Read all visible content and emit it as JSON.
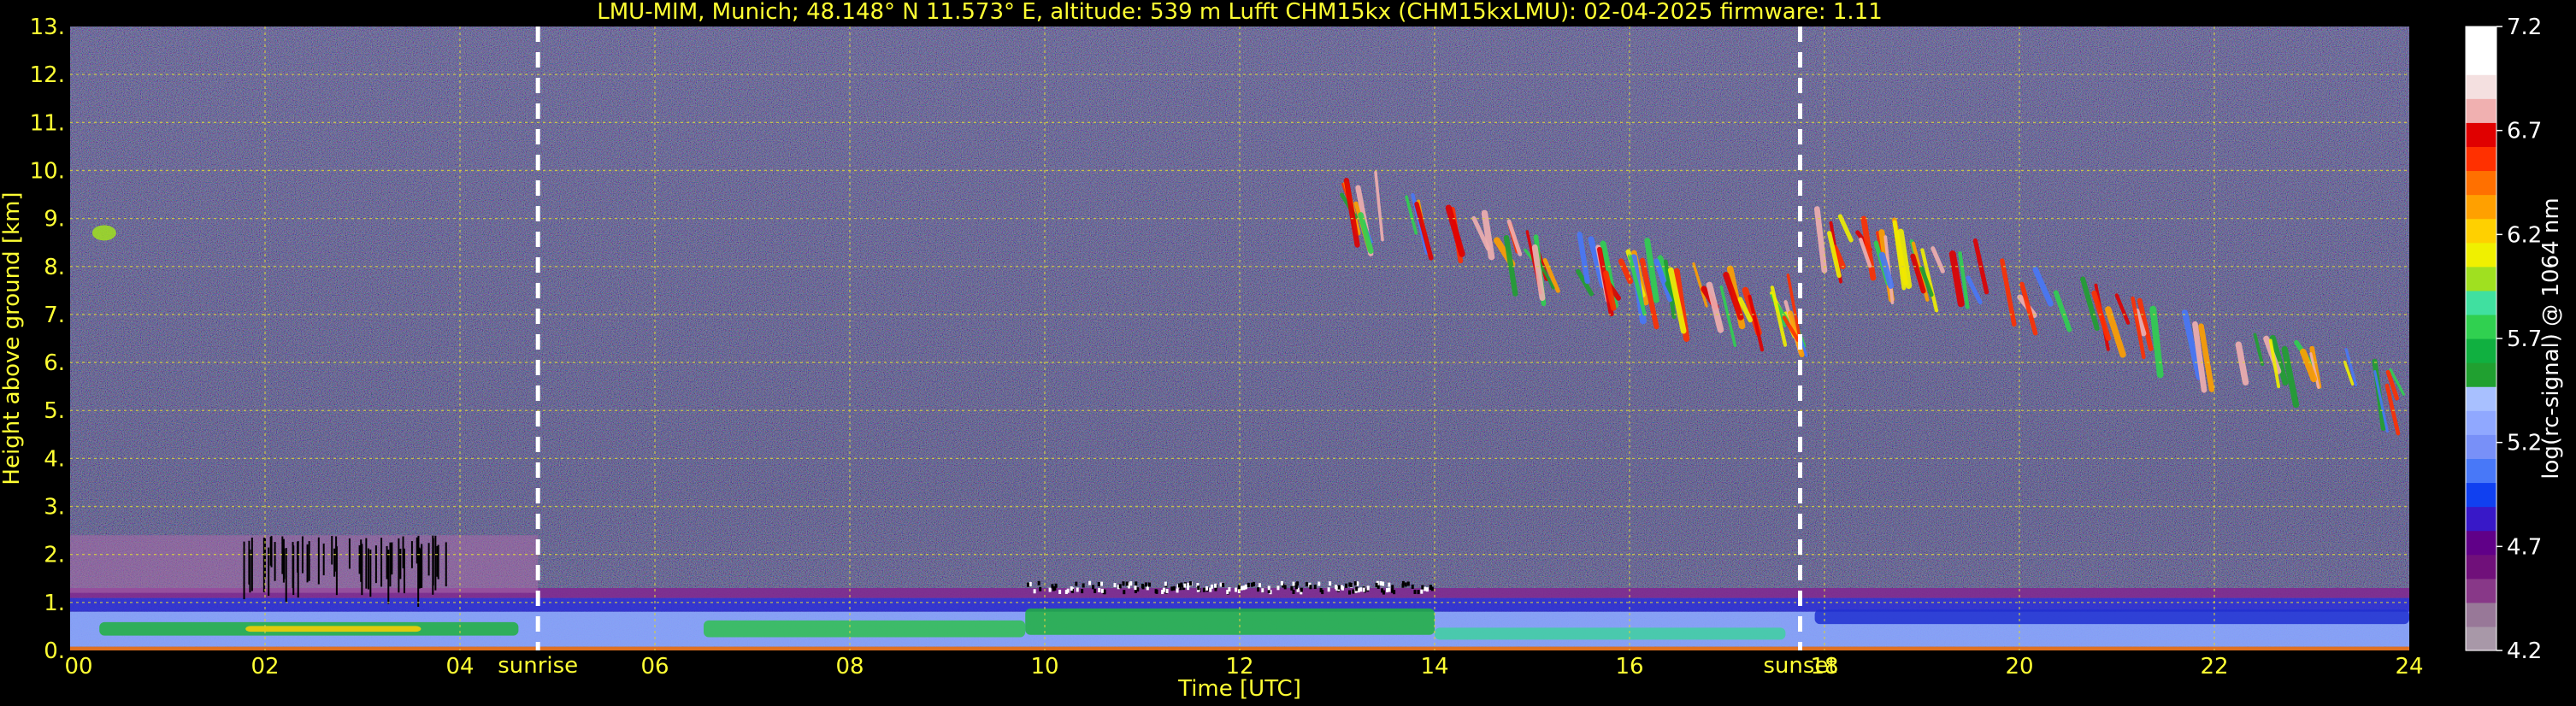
{
  "chart_data": {
    "type": "heatmap",
    "title": "LMU-MIM, Munich; 48.148° N 11.573° E, altitude: 539 m    Lufft CHM15kx (CHM15kxLMU): 02-04-2025    firmware: 1.11",
    "xlabel": "Time [UTC]",
    "ylabel": "Height above ground [km]",
    "xlim": [
      0,
      24
    ],
    "ylim": [
      0,
      13
    ],
    "x_ticks": [
      "00",
      "02",
      "04",
      "06",
      "08",
      "10",
      "12",
      "14",
      "16",
      "18",
      "20",
      "22",
      "24"
    ],
    "y_ticks": [
      "0.",
      "1.",
      "2.",
      "3.",
      "4.",
      "5.",
      "6.",
      "7.",
      "8.",
      "9.",
      "10.",
      "11.",
      "12.",
      "13."
    ],
    "grid": true,
    "colorbar": {
      "label": "log(rc-signal) @ 1064 nm",
      "range": [
        4.2,
        7.2
      ],
      "ticks": [
        "4.2",
        "4.7",
        "5.2",
        "5.7",
        "6.2",
        "6.7",
        "7.2"
      ],
      "colors": [
        "#a898a8",
        "#987898",
        "#883888",
        "#70107a",
        "#600088",
        "#3818c8",
        "#1040f0",
        "#4878f8",
        "#7890f8",
        "#90a8ff",
        "#a8c0ff",
        "#20a030",
        "#10b040",
        "#30d050",
        "#40e0a0",
        "#a0e020",
        "#f0f000",
        "#ffd000",
        "#ffa000",
        "#ff7000",
        "#ff3000",
        "#e00000",
        "#f0b0b0",
        "#f4e0e0",
        "#ffffff",
        "#ffffff"
      ]
    },
    "markers": [
      {
        "label": "sunrise",
        "x": 4.8
      },
      {
        "label": "sunset",
        "x": 17.75
      }
    ],
    "features": [
      {
        "kind": "boundary_layer",
        "x": [
          0,
          24
        ],
        "y": [
          0,
          1.3
        ]
      },
      {
        "kind": "aerosol_layer",
        "x": [
          0,
          4.8
        ],
        "y": [
          1.2,
          2.4
        ]
      },
      {
        "kind": "cirrus",
        "x": [
          13,
          17.7
        ],
        "y": [
          6.5,
          9.5
        ]
      },
      {
        "kind": "cirrus",
        "x": [
          17.9,
          24
        ],
        "y": [
          4.4,
          9.0
        ]
      }
    ]
  }
}
